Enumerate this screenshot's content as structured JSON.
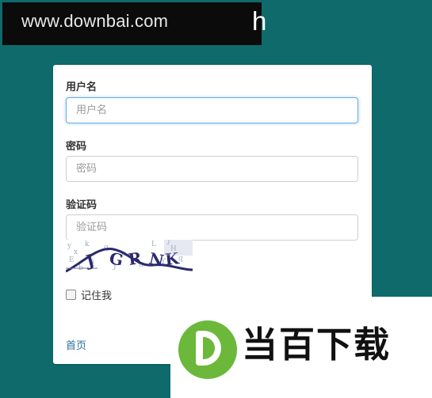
{
  "watermark": {
    "url": "www.downbai.com",
    "brand": "当百下载"
  },
  "header": {
    "title_fragment": "h"
  },
  "login_form": {
    "username": {
      "label": "用户名",
      "placeholder": "用户名",
      "value": ""
    },
    "password": {
      "label": "密码",
      "placeholder": "密码",
      "value": ""
    },
    "captcha": {
      "label": "验证码",
      "placeholder": "验证码",
      "value": "",
      "image_text": "JGRNK"
    },
    "remember_me": {
      "label": "记住我",
      "checked": false
    },
    "home_link": "首页"
  },
  "colors": {
    "background": "#0f6a6b",
    "card": "#ffffff",
    "focus_border": "#66afe9",
    "link": "#2a6f9e",
    "logo_green": "#6bb83a"
  }
}
